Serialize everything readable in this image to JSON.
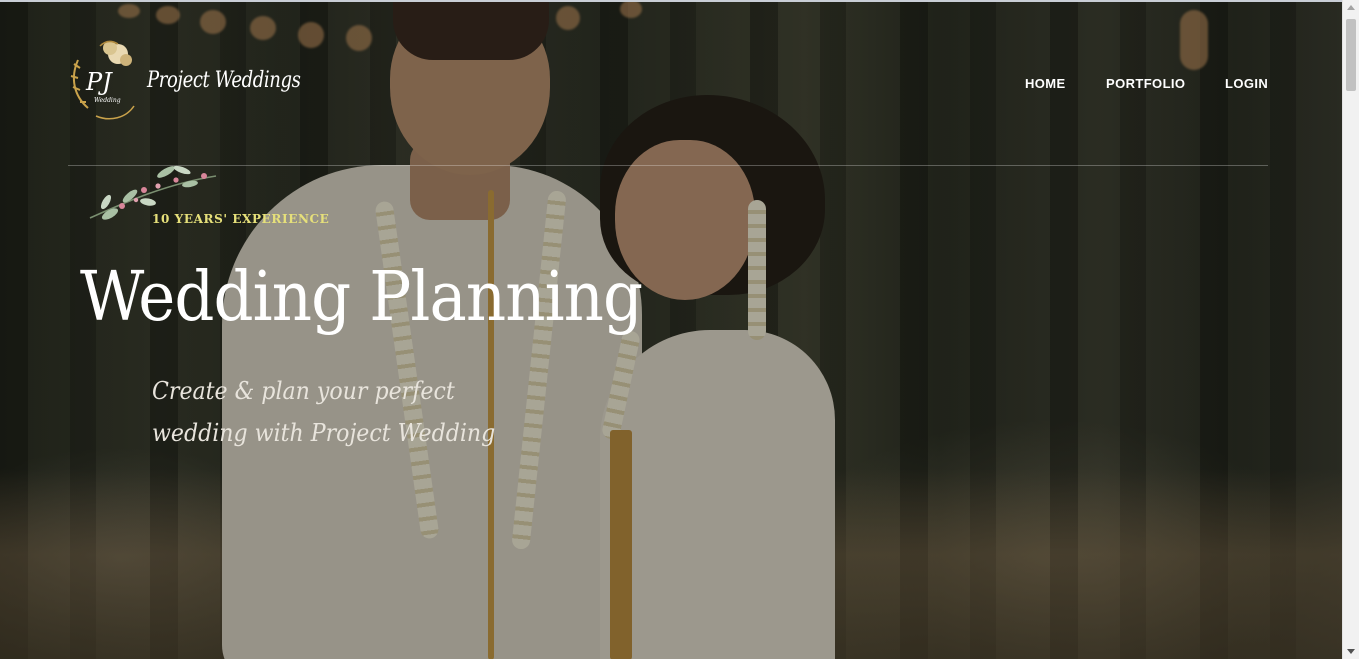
{
  "brand": {
    "monogram": "PJ",
    "monogram_sub": "Wedding",
    "name": "Project Weddings"
  },
  "nav": {
    "items": [
      {
        "label": "HOME"
      },
      {
        "label": "PORTFOLIO"
      },
      {
        "label": "LOGIN"
      }
    ]
  },
  "hero": {
    "badge": "10 YEARS' EXPERIENCE",
    "title": "Wedding Planning",
    "tagline_lines": [
      "Create & plan your perfect",
      "wedding with Project Wedding"
    ]
  },
  "colors": {
    "badge_text": "#e6e07a",
    "title_text": "#ffffff",
    "tagline_text": "#e8e4dc",
    "logo_gold": "#c9a24b"
  },
  "icons": {
    "logo_emblem": "gold-floral-wreath",
    "branch": "floral-branch"
  }
}
